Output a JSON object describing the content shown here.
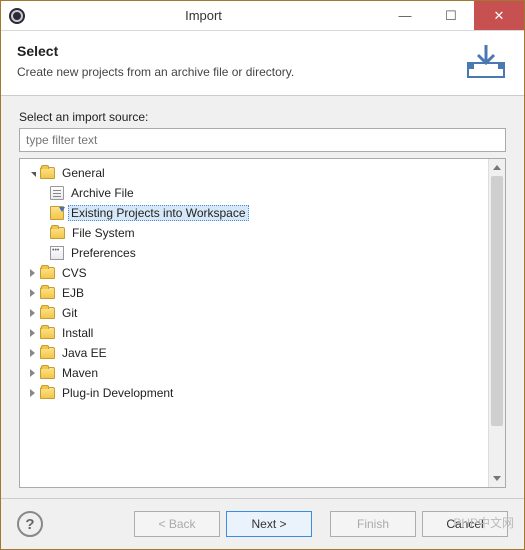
{
  "window": {
    "title": "Import"
  },
  "header": {
    "title": "Select",
    "description": "Create new projects from an archive file or directory."
  },
  "body": {
    "source_label": "Select an import source:",
    "filter_placeholder": "type filter text"
  },
  "tree": {
    "root": {
      "label": "General",
      "expanded": true,
      "children": [
        {
          "label": "Archive File",
          "icon": "doc"
        },
        {
          "label": "Existing Projects into Workspace",
          "icon": "import",
          "selected": true
        },
        {
          "label": "File System",
          "icon": "folder-leaf"
        },
        {
          "label": "Preferences",
          "icon": "prefs"
        }
      ]
    },
    "siblings": [
      {
        "label": "CVS"
      },
      {
        "label": "EJB"
      },
      {
        "label": "Git"
      },
      {
        "label": "Install"
      },
      {
        "label": "Java EE"
      },
      {
        "label": "Maven"
      },
      {
        "label": "Plug-in Development"
      }
    ]
  },
  "buttons": {
    "back": "< Back",
    "next": "Next >",
    "finish": "Finish",
    "cancel": "Cancel"
  },
  "watermark": "PHP中文网"
}
